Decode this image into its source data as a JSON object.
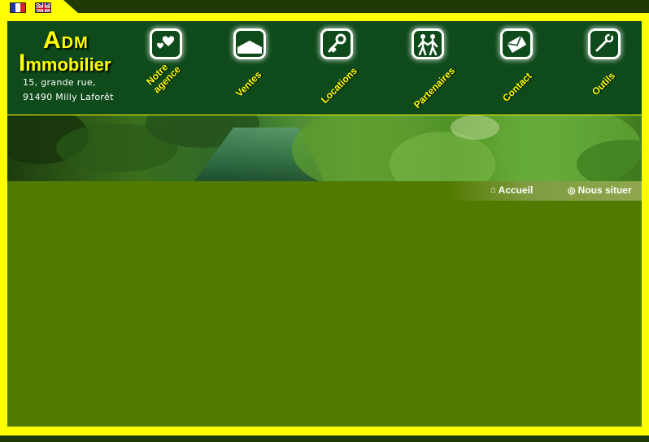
{
  "languages": [
    {
      "code": "fr",
      "icon": "flag-france-icon"
    },
    {
      "code": "en",
      "icon": "flag-uk-icon"
    }
  ],
  "brand": {
    "line1_initial": "A",
    "line1_rest": "DM",
    "line2_initial": "I",
    "line2_rest": "mmobilier",
    "address_line1": "15, grande rue,",
    "address_line2": "91490 Milly Laforêt"
  },
  "nav": [
    {
      "id": "agence",
      "label_line1": "Notre",
      "label_line2": "agence",
      "icon": "hearts-icon"
    },
    {
      "id": "ventes",
      "label_line1": "Ventes",
      "label_line2": "",
      "icon": "house-roof-icon"
    },
    {
      "id": "locations",
      "label_line1": "Locations",
      "label_line2": "",
      "icon": "key-icon"
    },
    {
      "id": "partenaires",
      "label_line1": "Partenaires",
      "label_line2": "",
      "icon": "handshake-people-icon"
    },
    {
      "id": "contact",
      "label_line1": "Contact",
      "label_line2": "",
      "icon": "envelope-icon"
    },
    {
      "id": "outils",
      "label_line1": "Outils",
      "label_line2": "",
      "icon": "wrench-icon"
    }
  ],
  "subnav": {
    "home_label": "Accueil",
    "locate_label": "Nous situer"
  },
  "colors": {
    "frame": "#ffff00",
    "header_bg": "#0e4a1a",
    "content_bg": "#517a00",
    "label": "#ffff00"
  }
}
